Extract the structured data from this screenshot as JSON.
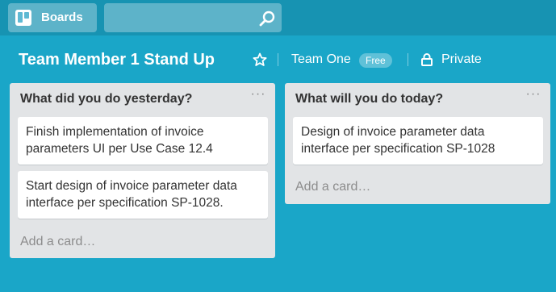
{
  "topbar": {
    "boards_label": "Boards",
    "boards_icon": "board-icon",
    "search": {
      "value": "",
      "placeholder": "",
      "icon": "search-icon"
    }
  },
  "board": {
    "title": "Team Member 1 Stand Up",
    "star_icon": "star-icon",
    "team": "Team One",
    "team_badge": "Free",
    "privacy_icon": "lock-icon",
    "privacy": "Private"
  },
  "lists": [
    {
      "title": "What did you do yesterday?",
      "menu": "···",
      "cards": [
        {
          "text": "Finish implementation of invoice parameters UI per Use Case 12.4"
        },
        {
          "text": "Start design of invoice parameter data interface per specification SP-1028."
        }
      ],
      "add_card": "Add a card…"
    },
    {
      "title": "What will you do today?",
      "menu": "···",
      "cards": [
        {
          "text": "Design of invoice parameter data interface per specification SP-1028"
        }
      ],
      "add_card": "Add a card…"
    }
  ],
  "colors": {
    "background": "#1aa6c8",
    "topbar": "#1793b2",
    "list": "#e2e4e6",
    "card": "#ffffff"
  }
}
